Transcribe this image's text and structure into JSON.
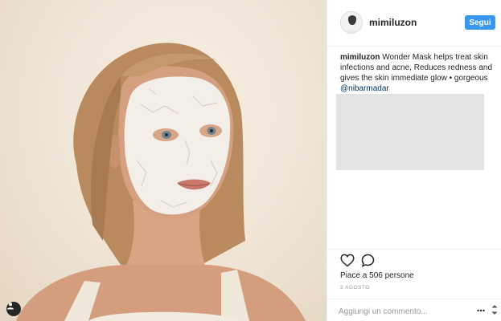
{
  "post": {
    "photo_alt": "woman-with-white-face-mask",
    "user_badge_icon": "person-icon"
  },
  "header": {
    "username": "mimiluzon",
    "follow_label": "Segui",
    "avatar_icon": "profile-avatar"
  },
  "caption": {
    "user": "mimiluzon",
    "text": " Wonder Mask helps treat skin infections and acne, Reduces redness and gives the skin immediate glow • gorgeous ",
    "mention": "@nibarmadar"
  },
  "actions": {
    "like_icon": "heart-icon",
    "comment_icon": "comment-icon"
  },
  "likes": {
    "text": "Piace a 506 persone"
  },
  "date": {
    "text": "3 AGOSTO"
  },
  "comment_box": {
    "placeholder": "Aggiungi un commento...",
    "more_icon": "more-options-icon"
  },
  "colors": {
    "accent": "#3897f0",
    "text": "#262626",
    "muted": "#999999",
    "divider": "#efefef",
    "placeholder_box": "#e3e3e3"
  }
}
